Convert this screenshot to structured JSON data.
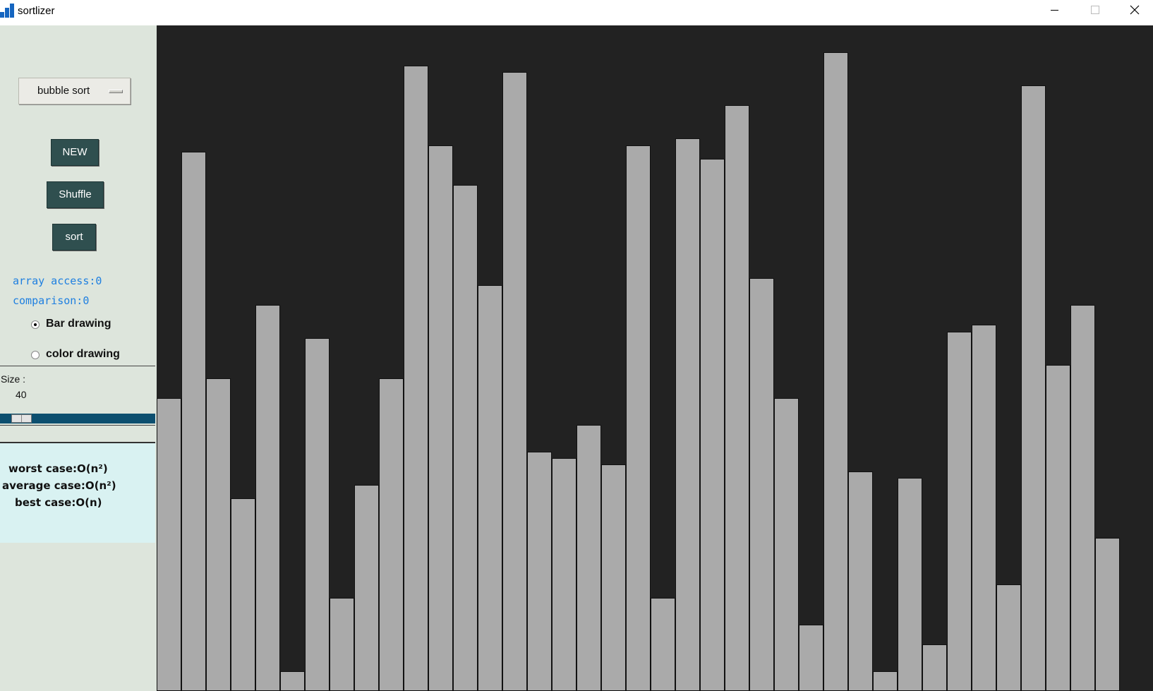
{
  "window": {
    "title": "sortlizer",
    "app_icon": "bar-chart-app-icon",
    "controls": [
      "minimize-icon",
      "maximize-icon",
      "close-icon"
    ]
  },
  "sidebar": {
    "algorithm_select": {
      "selected": "bubble sort"
    },
    "buttons": {
      "new_label": "NEW",
      "shuffle_label": "Shuffle",
      "sort_label": "sort"
    },
    "stats": {
      "array_access": "array access:0",
      "comparison": "comparison:0"
    },
    "drawing_modes": [
      {
        "label": "Bar drawing",
        "selected": true
      },
      {
        "label": "color drawing",
        "selected": false
      }
    ],
    "size": {
      "label": "Size :",
      "value": "40",
      "min": 0,
      "max": 400,
      "fraction": 0.1
    },
    "complexity": {
      "worst": "worst case:O(n²)",
      "average": "average case:O(n²)",
      "best": "best case:O(n)"
    }
  },
  "colors": {
    "sidebar_bg": "#dde5dc",
    "canvas_bg": "#222222",
    "bar": "#aaaaaa",
    "button_bg": "#2f4f4f",
    "stat_text": "#1e7fe0",
    "slider": "#0c4f6f",
    "complexity_bg": "#d9f2f2"
  },
  "bars": [
    44,
    81,
    47,
    29,
    58,
    3,
    53,
    14,
    31,
    47,
    94,
    82,
    76,
    61,
    93,
    36,
    35,
    40,
    34,
    82,
    14,
    83,
    80,
    88,
    62,
    44,
    10,
    96,
    33,
    3,
    32,
    7,
    54,
    55,
    16,
    91,
    49,
    58,
    23
  ]
}
